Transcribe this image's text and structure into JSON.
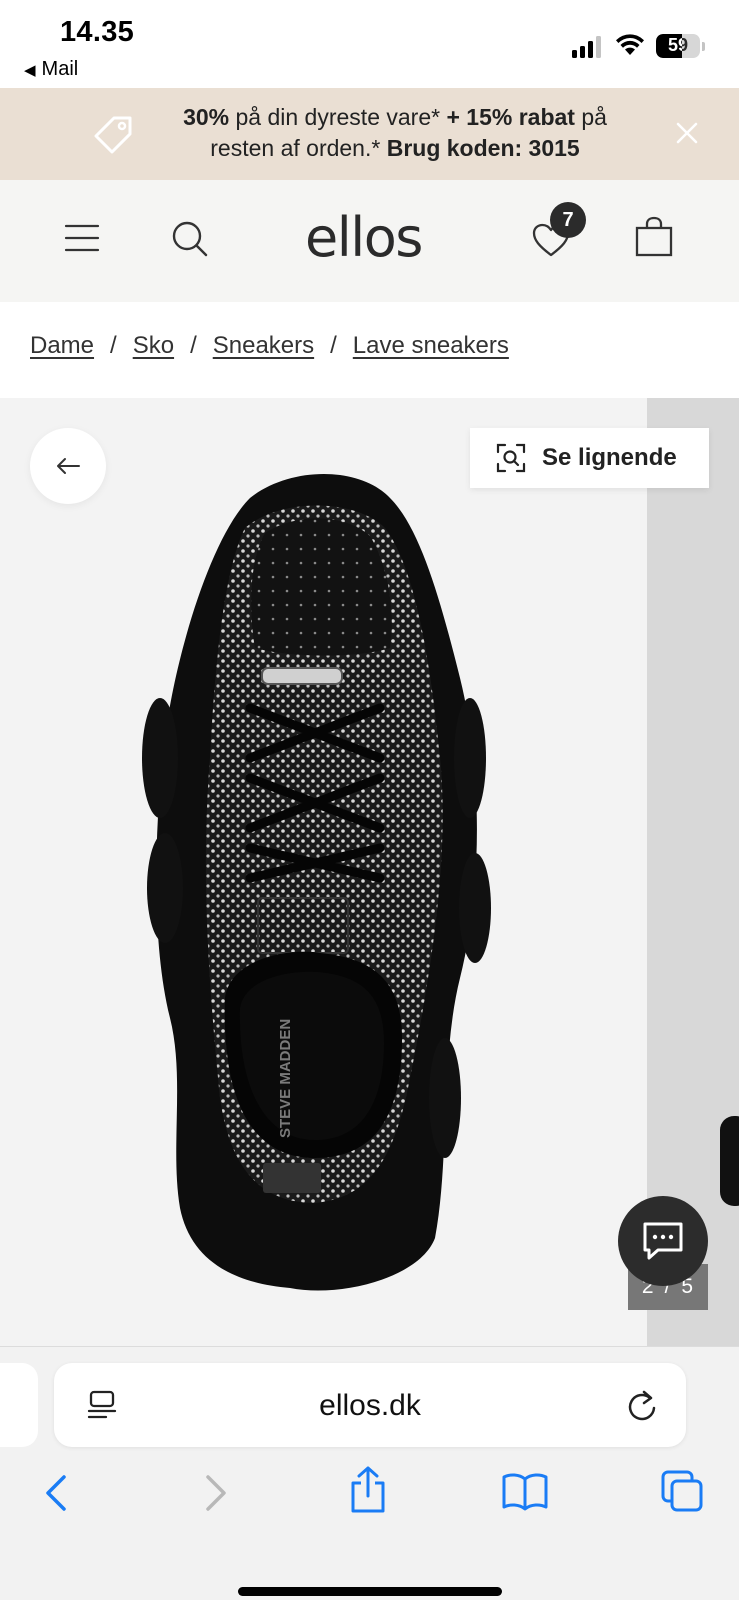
{
  "status_bar": {
    "time": "14.35",
    "back_app": "Mail",
    "battery_percent": "59",
    "battery_level": 0.59,
    "signal_bars": 3
  },
  "promo": {
    "line1_bold_a": "30%",
    "line1_text": " på din dyreste vare* ",
    "line1_bold_b": "+ 15% rabat",
    "line1_text_b": " på",
    "line2_text": "resten af orden.* ",
    "line2_bold": "Brug koden: 3015",
    "icons": [
      "tag-icon",
      "close-icon"
    ]
  },
  "header": {
    "logo": "ellos",
    "wishlist_count": "7",
    "icons": [
      "menu-icon",
      "search-icon",
      "heart-icon",
      "bag-icon"
    ]
  },
  "breadcrumb": {
    "items": [
      "Dame",
      "Sko",
      "Sneakers",
      "Lave sneakers"
    ],
    "separator": "/"
  },
  "gallery": {
    "similar_label": "Se lignende",
    "current": "2",
    "separator": "/",
    "total": "5",
    "insole_brand": "STEVE MADDEN"
  },
  "safari": {
    "url": "ellos.dk",
    "icons": [
      "reader-icon",
      "reload-icon",
      "back-icon",
      "forward-icon",
      "share-icon",
      "bookmarks-icon",
      "tabs-icon"
    ]
  },
  "colors": {
    "promo_bg": "#eadfd3",
    "header_bg": "#f5f5f3",
    "safari_blue": "#1a7cf5",
    "chat_bg": "#2c2c2c"
  }
}
